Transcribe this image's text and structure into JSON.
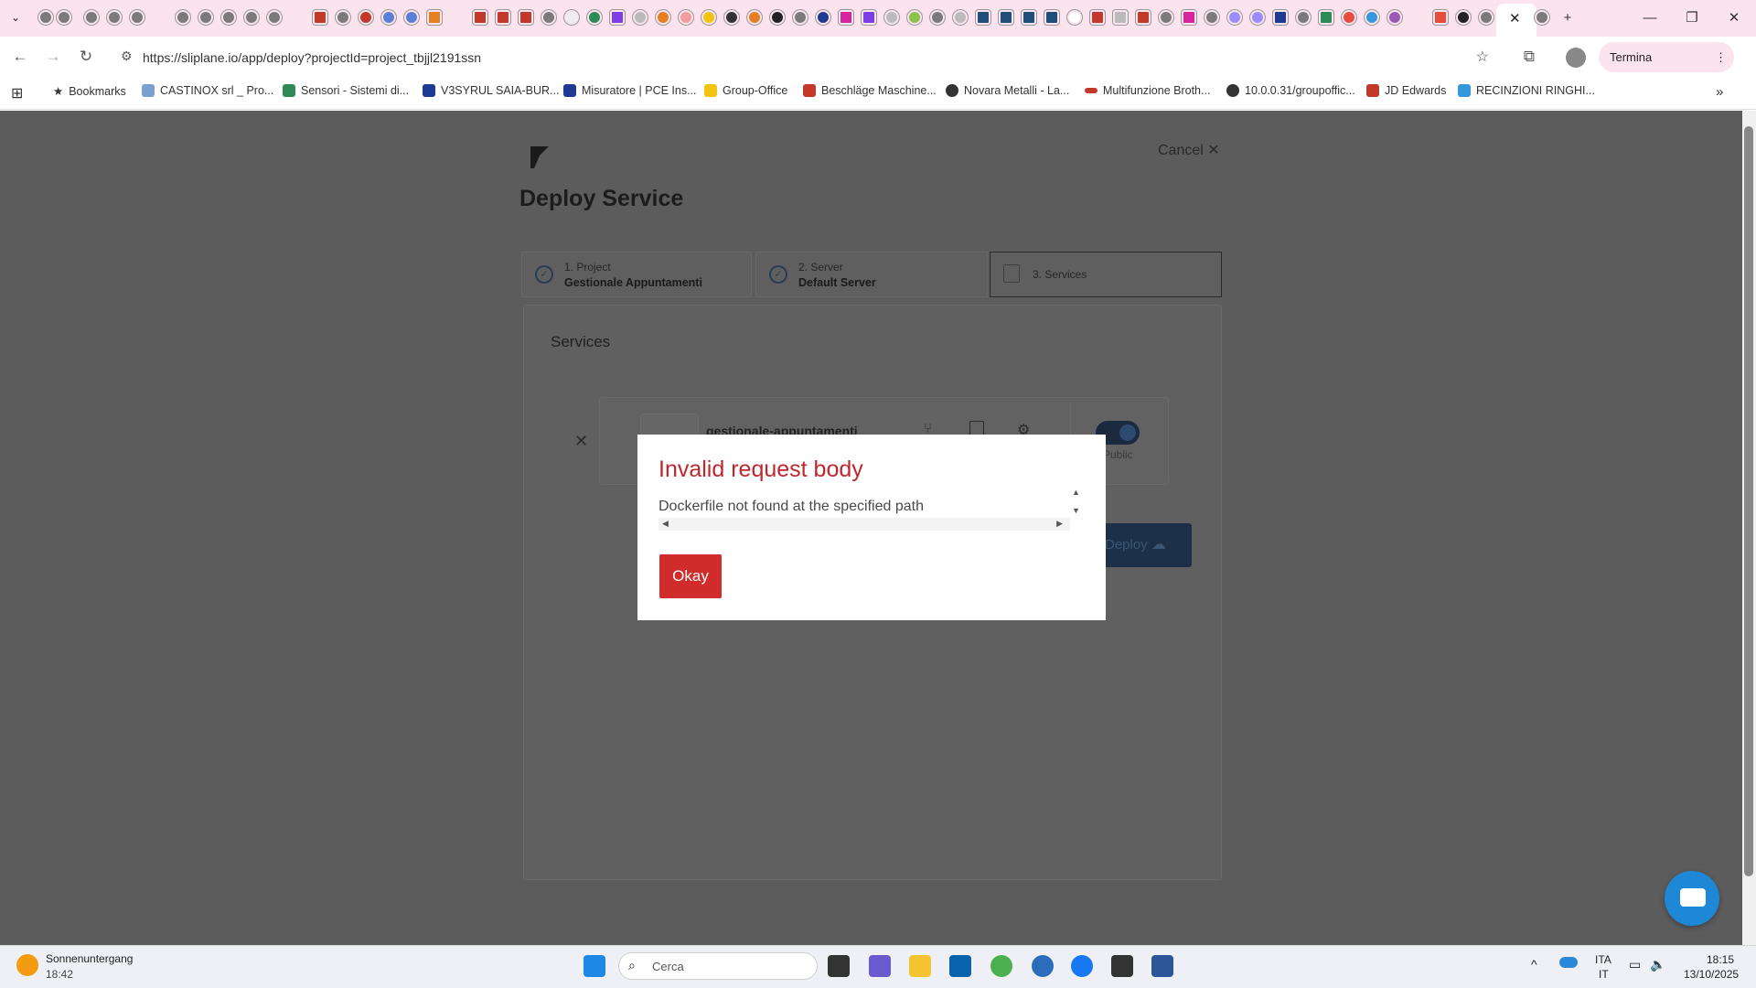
{
  "browser": {
    "url": "https://sliplane.io/app/deploy?projectId=project_tbjjl2191ssn",
    "update_button": "Termina aggiornamento",
    "bookmarks": [
      {
        "label": "Bookmarks"
      },
      {
        "label": "CASTINOX srl _ Pro..."
      },
      {
        "label": "Sensori - Sistemi di..."
      },
      {
        "label": "V3SYRUL SAIA-BUR..."
      },
      {
        "label": "Misuratore | PCE Ins..."
      },
      {
        "label": "Group-Office"
      },
      {
        "label": "Beschläge Maschine..."
      },
      {
        "label": "Novara Metalli - La..."
      },
      {
        "label": "Multifunzione Broth..."
      },
      {
        "label": "10.0.0.31/groupoffic..."
      },
      {
        "label": "JD Edwards"
      },
      {
        "label": "RECINZIONI RINGHI..."
      }
    ]
  },
  "page": {
    "title": "Deploy Service",
    "cancel_label": "Cancel",
    "steps": [
      {
        "num": "1. Project",
        "value": "Gestionale Appuntamenti"
      },
      {
        "num": "2. Server",
        "value": "Default Server"
      },
      {
        "num": "3. Services",
        "value": ""
      }
    ],
    "services_title": "Services",
    "service_name": "gestionale-appuntamenti",
    "public_label": "Public",
    "deploy_label": "Deploy"
  },
  "modal": {
    "title": "Invalid request body",
    "message": "Dockerfile not found at the specified path",
    "ok_label": "Okay"
  },
  "taskbar": {
    "weather_title": "Sonnenuntergang",
    "weather_time": "18:42",
    "search_placeholder": "Cerca",
    "lang_1": "ITA",
    "lang_2": "IT",
    "time": "18:15",
    "date": "13/10/2025"
  },
  "colors": {
    "modal_title": "#c0272d",
    "ok_button": "#d22b2b",
    "overlay": "#5c5c5c",
    "tabstrip": "#fce4ef"
  }
}
